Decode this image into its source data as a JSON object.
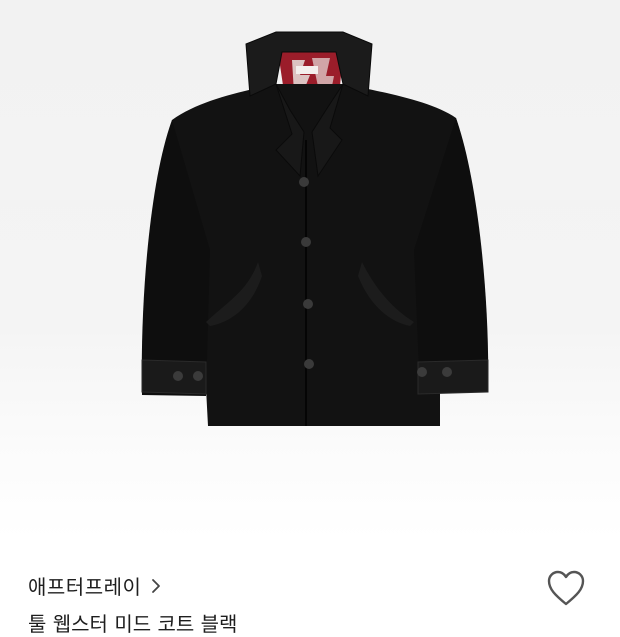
{
  "product": {
    "image_icon": "jacket-photo",
    "brand": "애프터프레이",
    "name": "툴 웹스터 미드 코트 블랙",
    "brand_chevron_icon": "chevron-right-icon",
    "wishlist_icon": "heart-outline-icon"
  },
  "colors": {
    "text": "#1e1e1e",
    "heart": "#555555",
    "jacket": "#121212",
    "lining": "#9b1d2a"
  }
}
